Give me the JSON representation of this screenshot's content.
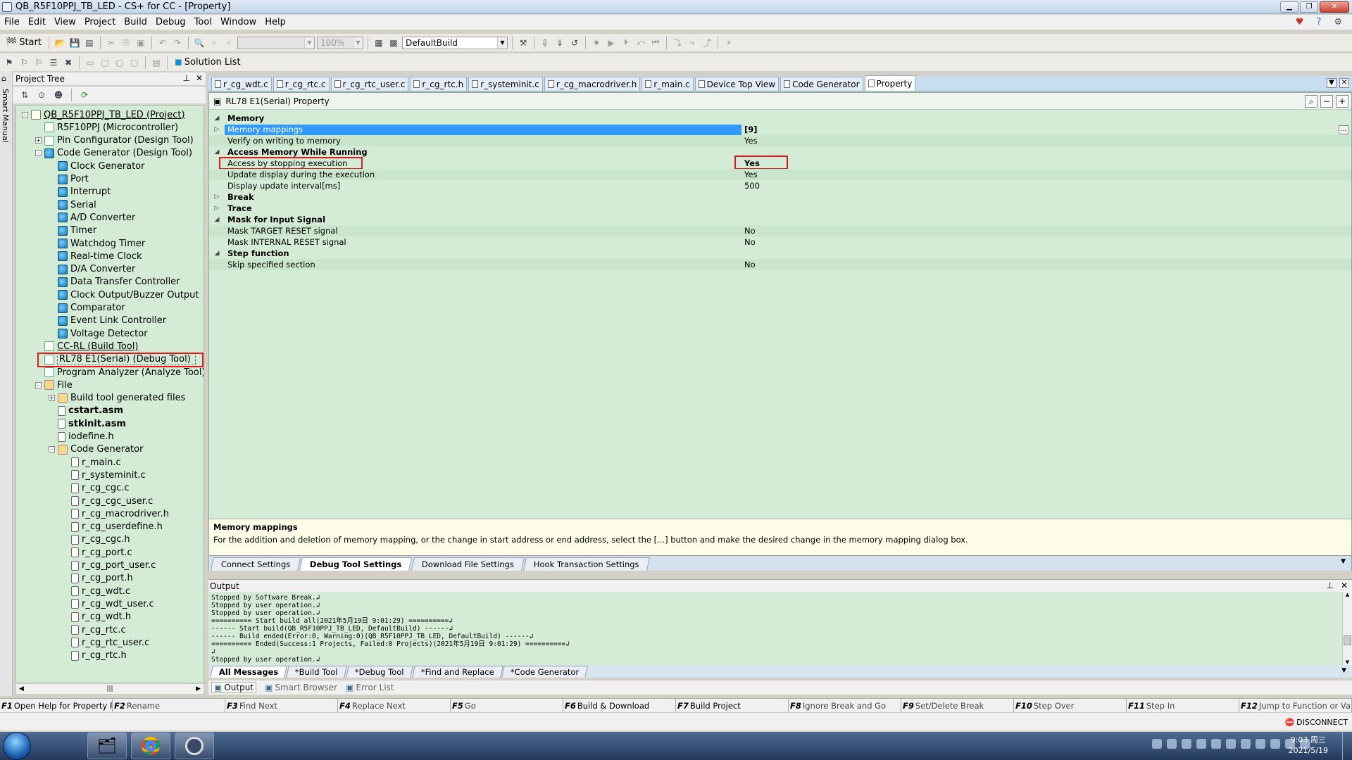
{
  "window": {
    "title": "QB_R5F10PPJ_TB_LED - CS+ for CC - [Property]"
  },
  "menu": [
    "File",
    "Edit",
    "View",
    "Project",
    "Build",
    "Debug",
    "Tool",
    "Window",
    "Help"
  ],
  "toolbar": {
    "start_label": "Start",
    "zoom_value": "100%",
    "build_config": "DefaultBuild",
    "solution_list_label": "Solution List"
  },
  "smart_manual_label": "Smart Manual",
  "project_tree": {
    "title": "Project Tree",
    "items": [
      {
        "label": "QB_R5F10PPJ_TB_LED (Project)",
        "depth": 0,
        "exp": "-",
        "icon": "proj",
        "style": "uline"
      },
      {
        "label": "R5F10PPJ (Microcontroller)",
        "depth": 1,
        "exp": "",
        "icon": "chip",
        "style": ""
      },
      {
        "label": "Pin Configurator (Design Tool)",
        "depth": 1,
        "exp": "+",
        "icon": "pin",
        "style": ""
      },
      {
        "label": "Code Generator (Design Tool)",
        "depth": 1,
        "exp": "-",
        "icon": "cg",
        "style": ""
      },
      {
        "label": "Clock Generator",
        "depth": 2,
        "exp": "",
        "icon": "cg",
        "style": ""
      },
      {
        "label": "Port",
        "depth": 2,
        "exp": "",
        "icon": "cg",
        "style": ""
      },
      {
        "label": "Interrupt",
        "depth": 2,
        "exp": "",
        "icon": "cg",
        "style": ""
      },
      {
        "label": "Serial",
        "depth": 2,
        "exp": "",
        "icon": "cg",
        "style": ""
      },
      {
        "label": "A/D Converter",
        "depth": 2,
        "exp": "",
        "icon": "cg",
        "style": ""
      },
      {
        "label": "Timer",
        "depth": 2,
        "exp": "",
        "icon": "cg",
        "style": ""
      },
      {
        "label": "Watchdog Timer",
        "depth": 2,
        "exp": "",
        "icon": "cg",
        "style": ""
      },
      {
        "label": "Real-time Clock",
        "depth": 2,
        "exp": "",
        "icon": "cg",
        "style": ""
      },
      {
        "label": "D/A Converter",
        "depth": 2,
        "exp": "",
        "icon": "cg",
        "style": ""
      },
      {
        "label": "Data Transfer Controller",
        "depth": 2,
        "exp": "",
        "icon": "cg",
        "style": ""
      },
      {
        "label": "Clock Output/Buzzer Output",
        "depth": 2,
        "exp": "",
        "icon": "cg",
        "style": ""
      },
      {
        "label": "Comparator",
        "depth": 2,
        "exp": "",
        "icon": "cg",
        "style": ""
      },
      {
        "label": "Event Link Controller",
        "depth": 2,
        "exp": "",
        "icon": "cg",
        "style": ""
      },
      {
        "label": "Voltage Detector",
        "depth": 2,
        "exp": "",
        "icon": "cg",
        "style": ""
      },
      {
        "label": "CC-RL (Build Tool)",
        "depth": 1,
        "exp": "",
        "icon": "hammer",
        "style": "uline"
      },
      {
        "label": "RL78 E1(Serial) (Debug Tool)",
        "depth": 1,
        "exp": "",
        "icon": "debug",
        "style": "selbox"
      },
      {
        "label": "Program Analyzer (Analyze Tool)",
        "depth": 1,
        "exp": "",
        "icon": "analyze",
        "style": ""
      },
      {
        "label": "File",
        "depth": 1,
        "exp": "-",
        "icon": "fold",
        "style": ""
      },
      {
        "label": "Build tool generated files",
        "depth": 2,
        "exp": "+",
        "icon": "fold",
        "style": ""
      },
      {
        "label": "cstart.asm",
        "depth": 2,
        "exp": "",
        "icon": "file",
        "style": "bold"
      },
      {
        "label": "stkinit.asm",
        "depth": 2,
        "exp": "",
        "icon": "file",
        "style": "bold"
      },
      {
        "label": "iodefine.h",
        "depth": 2,
        "exp": "",
        "icon": "file",
        "style": ""
      },
      {
        "label": "Code Generator",
        "depth": 2,
        "exp": "-",
        "icon": "fold",
        "style": ""
      },
      {
        "label": "r_main.c",
        "depth": 3,
        "exp": "",
        "icon": "file",
        "style": ""
      },
      {
        "label": "r_systeminit.c",
        "depth": 3,
        "exp": "",
        "icon": "file",
        "style": ""
      },
      {
        "label": "r_cg_cgc.c",
        "depth": 3,
        "exp": "",
        "icon": "file",
        "style": ""
      },
      {
        "label": "r_cg_cgc_user.c",
        "depth": 3,
        "exp": "",
        "icon": "file",
        "style": ""
      },
      {
        "label": "r_cg_macrodriver.h",
        "depth": 3,
        "exp": "",
        "icon": "file",
        "style": ""
      },
      {
        "label": "r_cg_userdefine.h",
        "depth": 3,
        "exp": "",
        "icon": "file",
        "style": ""
      },
      {
        "label": "r_cg_cgc.h",
        "depth": 3,
        "exp": "",
        "icon": "file",
        "style": ""
      },
      {
        "label": "r_cg_port.c",
        "depth": 3,
        "exp": "",
        "icon": "file",
        "style": ""
      },
      {
        "label": "r_cg_port_user.c",
        "depth": 3,
        "exp": "",
        "icon": "file",
        "style": ""
      },
      {
        "label": "r_cg_port.h",
        "depth": 3,
        "exp": "",
        "icon": "file",
        "style": ""
      },
      {
        "label": "r_cg_wdt.c",
        "depth": 3,
        "exp": "",
        "icon": "file",
        "style": ""
      },
      {
        "label": "r_cg_wdt_user.c",
        "depth": 3,
        "exp": "",
        "icon": "file",
        "style": ""
      },
      {
        "label": "r_cg_wdt.h",
        "depth": 3,
        "exp": "",
        "icon": "file",
        "style": ""
      },
      {
        "label": "r_cg_rtc.c",
        "depth": 3,
        "exp": "",
        "icon": "file",
        "style": ""
      },
      {
        "label": "r_cg_rtc_user.c",
        "depth": 3,
        "exp": "",
        "icon": "file",
        "style": ""
      },
      {
        "label": "r_cg_rtc.h",
        "depth": 3,
        "exp": "",
        "icon": "file",
        "style": ""
      }
    ]
  },
  "doc_tabs": [
    {
      "label": "r_cg_wdt.c",
      "active": false
    },
    {
      "label": "r_cg_rtc.c",
      "active": false
    },
    {
      "label": "r_cg_rtc_user.c",
      "active": false
    },
    {
      "label": "r_cg_rtc.h",
      "active": false
    },
    {
      "label": "r_systeminit.c",
      "active": false
    },
    {
      "label": "r_cg_macrodriver.h",
      "active": false
    },
    {
      "label": "r_main.c",
      "active": false
    },
    {
      "label": "Device Top View",
      "active": false
    },
    {
      "label": "Code Generator",
      "active": false
    },
    {
      "label": "Property",
      "active": true
    }
  ],
  "property": {
    "header": "RL78 E1(Serial) Property",
    "rows": [
      {
        "kind": "cat",
        "name": "Memory",
        "value": "",
        "gutter": "◢"
      },
      {
        "kind": "sel",
        "name": "Memory mappings",
        "value": "[9]",
        "gutter": "▷"
      },
      {
        "kind": "item",
        "name": "Verify on writing to memory",
        "value": "Yes",
        "gutter": ""
      },
      {
        "kind": "cat",
        "name": "Access Memory While Running",
        "value": "",
        "gutter": "◢"
      },
      {
        "kind": "item",
        "name": "Access by stopping execution",
        "value": "Yes",
        "gutter": "",
        "boxed": true
      },
      {
        "kind": "item",
        "name": "Update display during the execution",
        "value": "Yes",
        "gutter": ""
      },
      {
        "kind": "item",
        "name": "Display update interval[ms]",
        "value": "500",
        "gutter": ""
      },
      {
        "kind": "cat",
        "name": "Break",
        "value": "",
        "gutter": "▷"
      },
      {
        "kind": "cat",
        "name": "Trace",
        "value": "",
        "gutter": "▷"
      },
      {
        "kind": "cat",
        "name": "Mask for Input Signal",
        "value": "",
        "gutter": "◢"
      },
      {
        "kind": "item",
        "name": "Mask TARGET RESET signal",
        "value": "No",
        "gutter": ""
      },
      {
        "kind": "item",
        "name": "Mask INTERNAL RESET signal",
        "value": "No",
        "gutter": ""
      },
      {
        "kind": "cat",
        "name": "Step function",
        "value": "",
        "gutter": "◢"
      },
      {
        "kind": "item",
        "name": "Skip specified section",
        "value": "No",
        "gutter": ""
      }
    ],
    "desc_title": "Memory mappings",
    "desc_text": "For the addition and deletion of memory mapping, or the change in start address or end address, select the [...] button and make the desired change in the memory mapping dialog box.",
    "tabs": [
      {
        "label": "Connect Settings",
        "active": false
      },
      {
        "label": "Debug Tool Settings",
        "active": true
      },
      {
        "label": "Download File Settings",
        "active": false
      },
      {
        "label": "Hook Transaction Settings",
        "active": false
      }
    ]
  },
  "output": {
    "title": "Output",
    "lines": [
      "Stopped by Software Break.↲",
      "Stopped by user operation.↲",
      "Stopped by user operation.↲",
      "========== Start build all(2021年5月19日 9:01:29) ==========↲",
      "------ Start build(QB_R5F10PPJ_TB_LED, DefaultBuild) ------↲",
      "------ Build ended(Error:0, Warning:0)(QB_R5F10PPJ_TB_LED, DefaultBuild) ------↲",
      "========== Ended(Success:1 Projects, Failed:0 Projects)(2021年5月19日 9:01:29) ==========↲",
      "↲",
      "Stopped by user operation.↲"
    ],
    "tabs": [
      {
        "label": "All Messages",
        "active": true
      },
      {
        "label": "*Build Tool",
        "active": false
      },
      {
        "label": "*Debug Tool",
        "active": false
      },
      {
        "label": "*Find and Replace",
        "active": false
      },
      {
        "label": "*Code Generator",
        "active": false
      }
    ]
  },
  "panel_tabs": [
    {
      "label": "Output",
      "active": true
    },
    {
      "label": "Smart Browser",
      "active": false
    },
    {
      "label": "Error List",
      "active": false
    }
  ],
  "fkeys": [
    {
      "key": "F1",
      "label": "Open Help for Property P...",
      "enabled": true
    },
    {
      "key": "F2",
      "label": "Rename",
      "enabled": false
    },
    {
      "key": "F3",
      "label": "Find Next",
      "enabled": false
    },
    {
      "key": "F4",
      "label": "Replace Next",
      "enabled": false
    },
    {
      "key": "F5",
      "label": "Go",
      "enabled": false
    },
    {
      "key": "F6",
      "label": "Build & Download",
      "enabled": true
    },
    {
      "key": "F7",
      "label": "Build Project",
      "enabled": true
    },
    {
      "key": "F8",
      "label": "Ignore Break and Go",
      "enabled": false
    },
    {
      "key": "F9",
      "label": "Set/Delete Break",
      "enabled": false
    },
    {
      "key": "F10",
      "label": "Step Over",
      "enabled": false
    },
    {
      "key": "F11",
      "label": "Step In",
      "enabled": false
    },
    {
      "key": "F12",
      "label": "Jump to Function or Varia...",
      "enabled": false
    }
  ],
  "status": {
    "connection": "DISCONNECT"
  },
  "taskbar": {
    "time": "9:03 周三",
    "date": "2021/5/19"
  },
  "colors": {
    "grid_bg": "#d4ecd6",
    "selection": "#3399ff",
    "highlight_box": "#e8141e"
  }
}
